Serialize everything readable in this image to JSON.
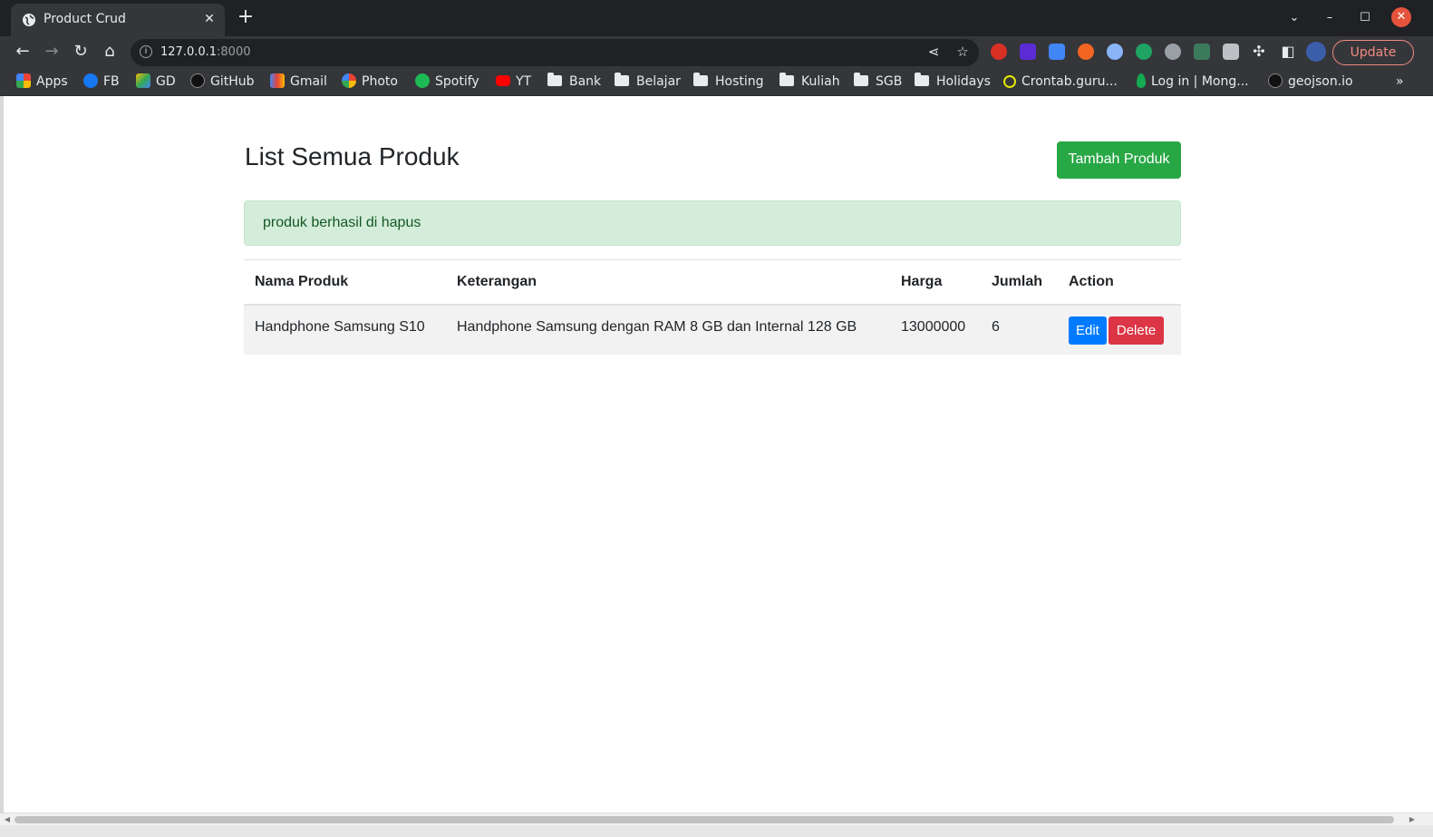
{
  "browser": {
    "tab_title": "Product Crud",
    "tab_close": "✕",
    "new_tab": "+",
    "url_host": "127.0.0.1",
    "url_port": ":8000",
    "update_label": "Update",
    "bookmarks": [
      {
        "label": "Apps",
        "icon": "apps-grid-icon",
        "color": "#4285f4"
      },
      {
        "label": "FB",
        "icon": "facebook-icon",
        "color": "#1877f2"
      },
      {
        "label": "GD",
        "icon": "google-drive-icon",
        "color": "#34a853"
      },
      {
        "label": "GitHub",
        "icon": "github-icon",
        "color": "#555555"
      },
      {
        "label": "Gmail",
        "icon": "gmail-icon",
        "color": "#ea4335"
      },
      {
        "label": "Photo",
        "icon": "google-photos-icon",
        "color": "#fbbc05"
      },
      {
        "label": "Spotify",
        "icon": "spotify-icon",
        "color": "#1db954"
      },
      {
        "label": "YT",
        "icon": "youtube-icon",
        "color": "#ff0000"
      },
      {
        "label": "Bank",
        "icon": "folder-icon"
      },
      {
        "label": "Belajar",
        "icon": "folder-icon"
      },
      {
        "label": "Hosting",
        "icon": "folder-icon"
      },
      {
        "label": "Kuliah",
        "icon": "folder-icon"
      },
      {
        "label": "SGB",
        "icon": "folder-icon"
      },
      {
        "label": "Holidays",
        "icon": "folder-icon"
      },
      {
        "label": "Crontab.guru...",
        "icon": "crontab-icon",
        "color": "#e5e500"
      },
      {
        "label": "Log in | Mong...",
        "icon": "mongodb-icon",
        "color": "#13aa52"
      },
      {
        "label": "geojson.io",
        "icon": "geojson-icon",
        "color": "#111111"
      }
    ],
    "overflow": "»"
  },
  "page": {
    "heading": "List Semua Produk",
    "add_button": "Tambah Produk",
    "alert": "produk berhasil di hapus",
    "table": {
      "headers": [
        "Nama Produk",
        "Keterangan",
        "Harga",
        "Jumlah",
        "Action"
      ],
      "rows": [
        {
          "nama": "Handphone Samsung S10",
          "keterangan": "Handphone Samsung dengan RAM 8 GB dan Internal 128 GB",
          "harga": "13000000",
          "jumlah": "6",
          "edit": "Edit",
          "delete": "Delete"
        }
      ]
    }
  },
  "colors": {
    "success": "#28a745",
    "primary": "#007bff",
    "danger": "#dc3545",
    "alert_bg": "#d4edda",
    "alert_text": "#155724"
  }
}
